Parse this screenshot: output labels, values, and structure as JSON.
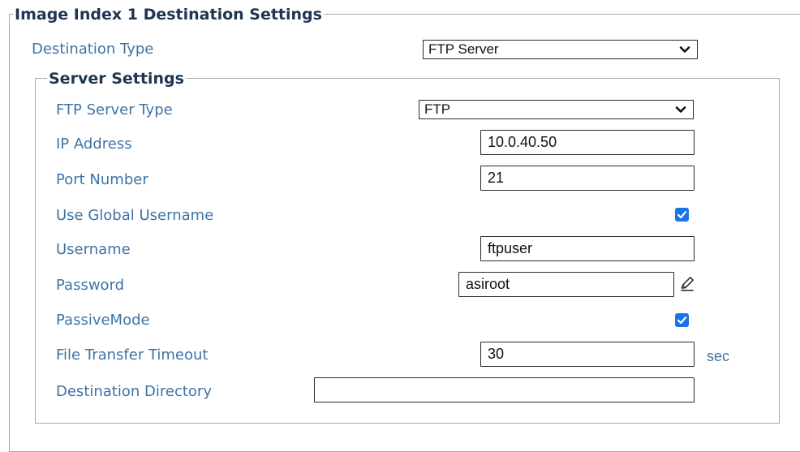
{
  "outer_group": {
    "title": "Image Index 1 Destination Settings"
  },
  "destination_type": {
    "label": "Destination Type",
    "selected": "FTP Server"
  },
  "server_group": {
    "title": "Server Settings"
  },
  "ftp_server_type": {
    "label": "FTP Server Type",
    "selected": "FTP"
  },
  "ip_address": {
    "label": "IP Address",
    "value": "10.0.40.50"
  },
  "port_number": {
    "label": "Port Number",
    "value": "21"
  },
  "use_global_username": {
    "label": "Use Global Username",
    "checked": true
  },
  "username": {
    "label": "Username",
    "value": "ftpuser"
  },
  "password": {
    "label": "Password",
    "value": "asiroot",
    "edit_icon": "pencil-icon"
  },
  "passive_mode": {
    "label": "PassiveMode",
    "checked": true
  },
  "file_transfer_timeout": {
    "label": "File Transfer Timeout",
    "value": "30",
    "unit": "sec"
  },
  "destination_directory": {
    "label": "Destination Directory",
    "value": ""
  },
  "colors": {
    "label": "#3f73a6",
    "legend": "#1e3550",
    "checkbox": "#1a73e8",
    "border": "#a8a8a8"
  }
}
